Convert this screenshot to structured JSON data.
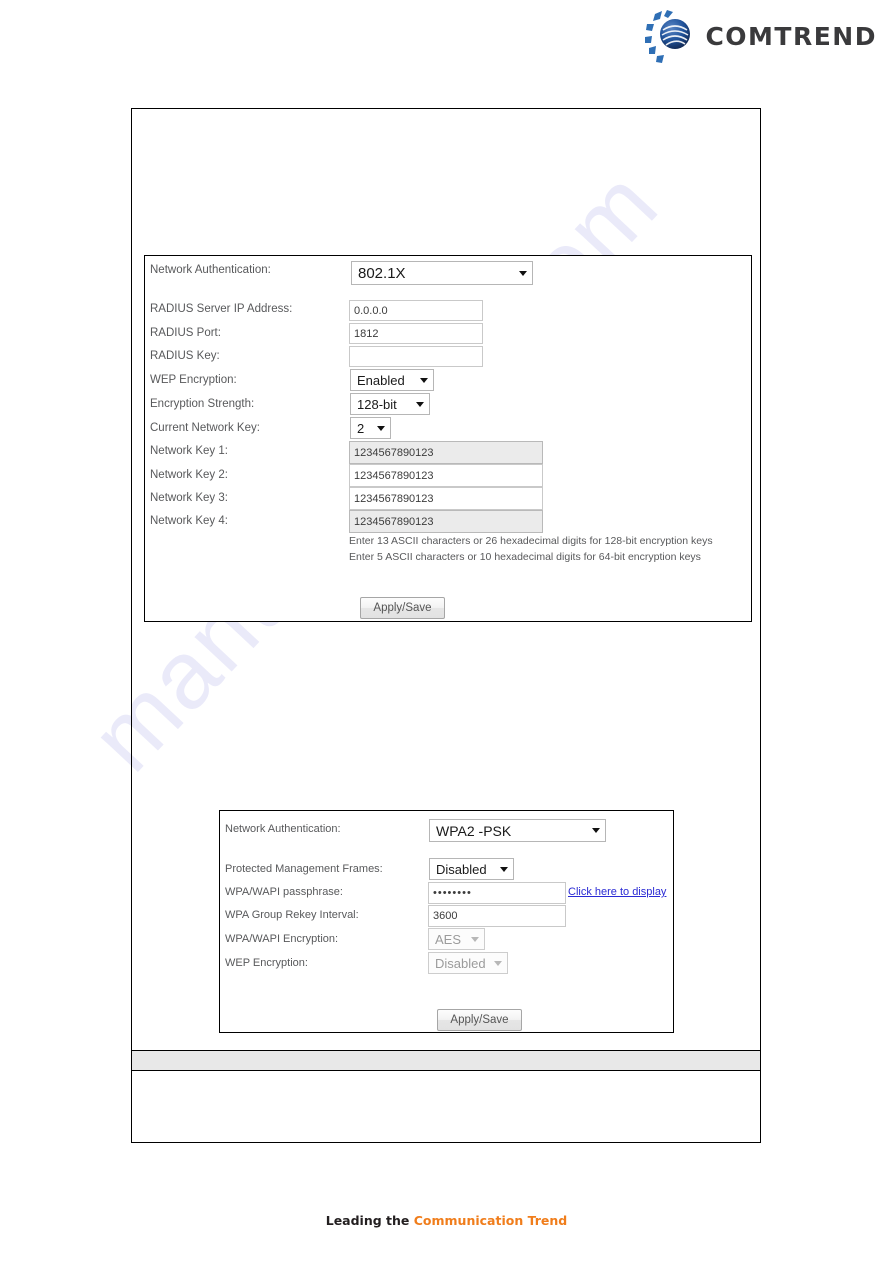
{
  "brand": {
    "logo_icon": "comtrend-globe-icon",
    "wordmark": "COMTREND"
  },
  "footer": {
    "lead": "Leading the ",
    "accent1": "Communication",
    "mid": " ",
    "accent2": "Trend"
  },
  "panel_8021x": {
    "name": "network-authentication-802-1x-panel",
    "auth": {
      "label": "Network Authentication:",
      "value": "802.1X"
    },
    "fields": [
      {
        "label": "RADIUS Server IP Address:",
        "value": "0.0.0.0",
        "shaded": false
      },
      {
        "label": "RADIUS Port:",
        "value": "1812",
        "shaded": false
      },
      {
        "label": "RADIUS Key:",
        "value": "",
        "shaded": false
      }
    ],
    "selects": [
      {
        "label": "WEP Encryption:",
        "value": "Enabled",
        "disabled": false
      },
      {
        "label": "Encryption Strength:",
        "value": "128-bit",
        "disabled": false
      },
      {
        "label": "Current Network Key:",
        "value": "2",
        "disabled": false
      }
    ],
    "keys": [
      {
        "label": "Network Key 1:",
        "value": "1234567890123",
        "shaded": true
      },
      {
        "label": "Network Key 2:",
        "value": "1234567890123",
        "shaded": false
      },
      {
        "label": "Network Key 3:",
        "value": "1234567890123",
        "shaded": false
      },
      {
        "label": "Network Key 4:",
        "value": "1234567890123",
        "shaded": true
      }
    ],
    "hints": [
      "Enter 13 ASCII characters or 26 hexadecimal digits for 128-bit encryption keys",
      "Enter 5 ASCII characters or 10 hexadecimal digits for 64-bit encryption keys"
    ],
    "apply_button": "Apply/Save"
  },
  "panel_wpa2": {
    "name": "network-authentication-wpa2-psk-panel",
    "auth": {
      "label": "Network Authentication:",
      "value": "WPA2 -PSK"
    },
    "pmf": {
      "label": "Protected Management Frames:",
      "value": "Disabled"
    },
    "passphrase": {
      "label": "WPA/WAPI passphrase:",
      "value": "••••••••",
      "display_link": "Click here to display"
    },
    "rekey": {
      "label": "WPA Group Rekey Interval:",
      "value": "3600"
    },
    "wpa_encryption": {
      "label": "WPA/WAPI Encryption:",
      "value": "AES",
      "disabled": true
    },
    "wep_encryption": {
      "label": "WEP Encryption:",
      "value": "Disabled",
      "disabled": true
    },
    "apply_button": "Apply/Save"
  },
  "watermark": {
    "text": "manualshive.com"
  }
}
